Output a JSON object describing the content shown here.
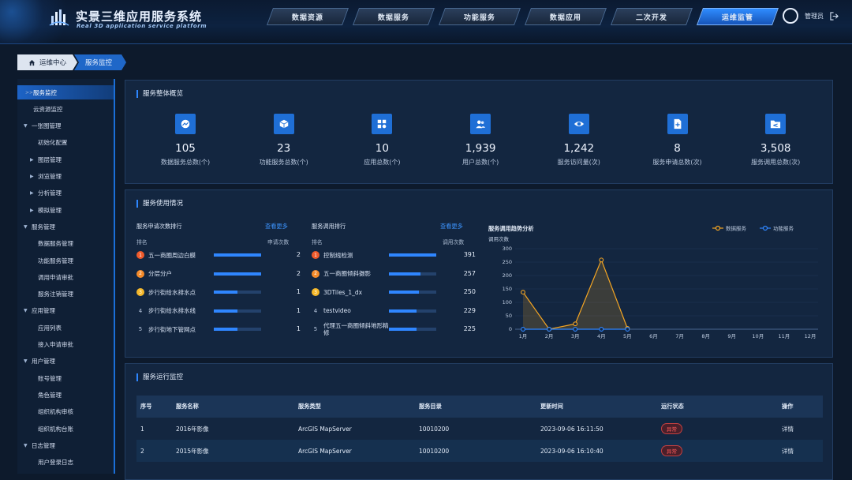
{
  "app": {
    "title": "实景三维应用服务系统",
    "subtitle": "Real 3D application service platform"
  },
  "nav": [
    {
      "label": "数据资源",
      "active": false
    },
    {
      "label": "数据服务",
      "active": false
    },
    {
      "label": "功能服务",
      "active": false
    },
    {
      "label": "数据应用",
      "active": false
    },
    {
      "label": "二次开发",
      "active": false
    },
    {
      "label": "运维监管",
      "active": true
    }
  ],
  "user": {
    "name": "管理员"
  },
  "breadcrumb": {
    "home": "运维中心",
    "current": "服务监控"
  },
  "sidebar": [
    {
      "label": "服务监控",
      "level": 1,
      "active": true,
      "marker": ">>"
    },
    {
      "label": "云资源监控",
      "level": 1
    },
    {
      "label": "一张图管理",
      "level": 0,
      "marker": "▼"
    },
    {
      "label": "初始化配置",
      "level": 2
    },
    {
      "label": "图层管理",
      "level": 2,
      "marker": "▶"
    },
    {
      "label": "浏览管理",
      "level": 2,
      "marker": "▶"
    },
    {
      "label": "分析管理",
      "level": 2,
      "marker": "▶"
    },
    {
      "label": "模拟管理",
      "level": 2,
      "marker": "▶"
    },
    {
      "label": "服务管理",
      "level": 0,
      "marker": "▼"
    },
    {
      "label": "数据服务管理",
      "level": 2
    },
    {
      "label": "功能服务管理",
      "level": 2
    },
    {
      "label": "调用申请审批",
      "level": 2
    },
    {
      "label": "服务注销管理",
      "level": 2
    },
    {
      "label": "应用管理",
      "level": 0,
      "marker": "▼"
    },
    {
      "label": "应用列表",
      "level": 2
    },
    {
      "label": "接入申请审批",
      "level": 2
    },
    {
      "label": "用户管理",
      "level": 0,
      "marker": "▼"
    },
    {
      "label": "账号管理",
      "level": 2
    },
    {
      "label": "角色管理",
      "level": 2
    },
    {
      "label": "组织机构审核",
      "level": 2
    },
    {
      "label": "组织机构台账",
      "level": 2
    },
    {
      "label": "日志管理",
      "level": 0,
      "marker": "▼"
    },
    {
      "label": "用户登录日志",
      "level": 2
    }
  ],
  "overview": {
    "title": "服务整体概览",
    "stats": [
      {
        "value": "105",
        "label": "数据服务总数(个)",
        "icon": "messenger-icon"
      },
      {
        "value": "23",
        "label": "功能服务总数(个)",
        "icon": "cube-icon"
      },
      {
        "value": "10",
        "label": "应用总数(个)",
        "icon": "apps-grid-icon"
      },
      {
        "value": "1,939",
        "label": "用户总数(个)",
        "icon": "users-icon"
      },
      {
        "value": "1,242",
        "label": "服务访问量(次)",
        "icon": "eye-icon"
      },
      {
        "value": "8",
        "label": "服务申请总数(次)",
        "icon": "document-add-icon"
      },
      {
        "value": "3,508",
        "label": "服务调用总数(次)",
        "icon": "folder-share-icon"
      }
    ]
  },
  "usage": {
    "title": "服务使用情况",
    "apply_rank": {
      "title": "服务申请次数排行",
      "more": "查看更多",
      "col_rank": "排名",
      "col_value": "申请次数",
      "rows": [
        {
          "rank": "1",
          "name": "五一商圈周边白膜",
          "value": "2",
          "ratio": 1.0
        },
        {
          "rank": "2",
          "name": "分层分户",
          "value": "2",
          "ratio": 1.0
        },
        {
          "rank": "3",
          "name": "步行街给水排水点",
          "value": "1",
          "ratio": 0.5
        },
        {
          "rank": "4",
          "name": "步行街给水排水线",
          "value": "1",
          "ratio": 0.5
        },
        {
          "rank": "5",
          "name": "步行街地下管网点",
          "value": "1",
          "ratio": 0.5
        }
      ]
    },
    "call_rank": {
      "title": "服务调用排行",
      "more": "查看更多",
      "col_rank": "排名",
      "col_value": "调用次数",
      "rows": [
        {
          "rank": "1",
          "name": "控制线检测",
          "value": "391",
          "ratio": 1.0
        },
        {
          "rank": "2",
          "name": "五一商圈倾斜摄影",
          "value": "257",
          "ratio": 0.66
        },
        {
          "rank": "3",
          "name": "3DTiles_1_dx",
          "value": "250",
          "ratio": 0.64
        },
        {
          "rank": "4",
          "name": "testvideo",
          "value": "229",
          "ratio": 0.59
        },
        {
          "rank": "5",
          "name": "代理五一商圈倾斜地形精修",
          "value": "225",
          "ratio": 0.58
        }
      ]
    }
  },
  "chart_data": {
    "type": "line",
    "title": "服务调用趋势分析",
    "ylabel": "调用次数",
    "categories": [
      "1月",
      "2月",
      "3月",
      "4月",
      "5月",
      "6月",
      "7月",
      "8月",
      "9月",
      "10月",
      "11月",
      "12月"
    ],
    "ylim": [
      0,
      300
    ],
    "yticks": [
      0,
      50,
      100,
      150,
      200,
      250,
      300
    ],
    "legend": "top-right",
    "series": [
      {
        "name": "数据服务",
        "color": "#f5a623",
        "values": [
          138,
          0,
          20,
          258,
          3
        ]
      },
      {
        "name": "功能服务",
        "color": "#2f86ff",
        "values": [
          0,
          0,
          0,
          0,
          0
        ]
      }
    ]
  },
  "monitor": {
    "title": "服务运行监控",
    "columns": [
      "序号",
      "服务名称",
      "服务类型",
      "服务目录",
      "更新时间",
      "运行状态",
      "操作"
    ],
    "rows": [
      {
        "no": "1",
        "name": "2016年影像",
        "type": "ArcGIS MapServer",
        "dir": "10010200",
        "time": "2023-09-06 16:11:50",
        "status": "异常",
        "action": "详情"
      },
      {
        "no": "2",
        "name": "2015年影像",
        "type": "ArcGIS MapServer",
        "dir": "10010200",
        "time": "2023-09-06 16:10:40",
        "status": "异常",
        "action": "详情"
      }
    ]
  }
}
